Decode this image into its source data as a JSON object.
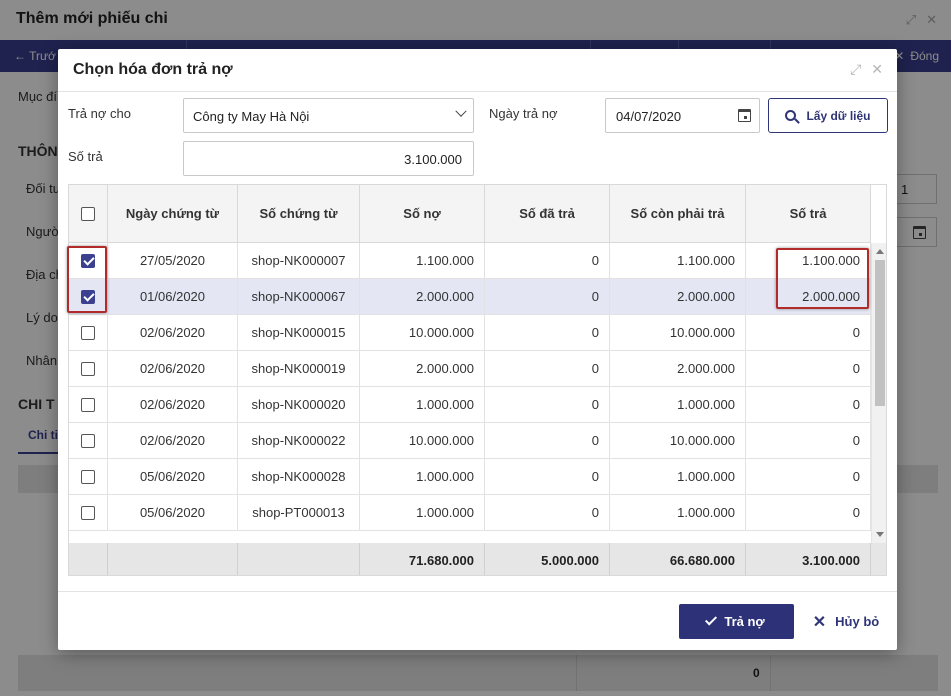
{
  "background": {
    "title": "Thêm mới phiếu chi",
    "toolbar": {
      "prev_label": "Trướ",
      "close_label": "Đóng"
    },
    "labels": {
      "muc_dich": "Mục đí",
      "thong_tin": "THÔN",
      "doi_tuong": "Đối tư",
      "nguoi": "Người",
      "dia_chi": "Địa ch",
      "ly_do": "Lý do",
      "nhan": "Nhân",
      "chi_tiet": "CHI T",
      "tab_chi_tiet": "Chi ti"
    },
    "right_field_value": "1",
    "footer_total": "0"
  },
  "dialog": {
    "title": "Chọn hóa đơn trả nợ",
    "tra_no_cho_label": "Trả nợ cho",
    "tra_no_cho_value": "Công ty May Hà Nội",
    "ngay_tra_no_label": "Ngày trả nợ",
    "ngay_tra_no_value": "04/07/2020",
    "fetch_button": "Lấy dữ liệu",
    "so_tra_label": "Số trả",
    "so_tra_value": "3.100.000",
    "columns": [
      "Ngày chứng từ",
      "Số chứng từ",
      "Số nợ",
      "Số đã trả",
      "Số còn phải trả",
      "Số trả"
    ],
    "rows": [
      {
        "checked": true,
        "date": "27/05/2020",
        "doc": "shop-NK000007",
        "debt": "1.100.000",
        "paid": "0",
        "remaining": "1.100.000",
        "pay": "1.100.000"
      },
      {
        "checked": true,
        "date": "01/06/2020",
        "doc": "shop-NK000067",
        "debt": "2.000.000",
        "paid": "0",
        "remaining": "2.000.000",
        "pay": "2.000.000"
      },
      {
        "checked": false,
        "date": "02/06/2020",
        "doc": "shop-NK000015",
        "debt": "10.000.000",
        "paid": "0",
        "remaining": "10.000.000",
        "pay": "0"
      },
      {
        "checked": false,
        "date": "02/06/2020",
        "doc": "shop-NK000019",
        "debt": "2.000.000",
        "paid": "0",
        "remaining": "2.000.000",
        "pay": "0"
      },
      {
        "checked": false,
        "date": "02/06/2020",
        "doc": "shop-NK000020",
        "debt": "1.000.000",
        "paid": "0",
        "remaining": "1.000.000",
        "pay": "0"
      },
      {
        "checked": false,
        "date": "02/06/2020",
        "doc": "shop-NK000022",
        "debt": "10.000.000",
        "paid": "0",
        "remaining": "10.000.000",
        "pay": "0"
      },
      {
        "checked": false,
        "date": "05/06/2020",
        "doc": "shop-NK000028",
        "debt": "1.000.000",
        "paid": "0",
        "remaining": "1.000.000",
        "pay": "0"
      },
      {
        "checked": false,
        "date": "05/06/2020",
        "doc": "shop-PT000013",
        "debt": "1.000.000",
        "paid": "0",
        "remaining": "1.000.000",
        "pay": "0"
      }
    ],
    "totals": {
      "debt": "71.680.000",
      "paid": "5.000.000",
      "remaining": "66.680.000",
      "pay": "3.100.000"
    },
    "confirm_button": "Trả nợ",
    "cancel_button": "Hủy bỏ",
    "colors": {
      "primary": "#2d3177",
      "selected_row": "#e4e6f4",
      "highlight": "#b12b2b"
    }
  }
}
